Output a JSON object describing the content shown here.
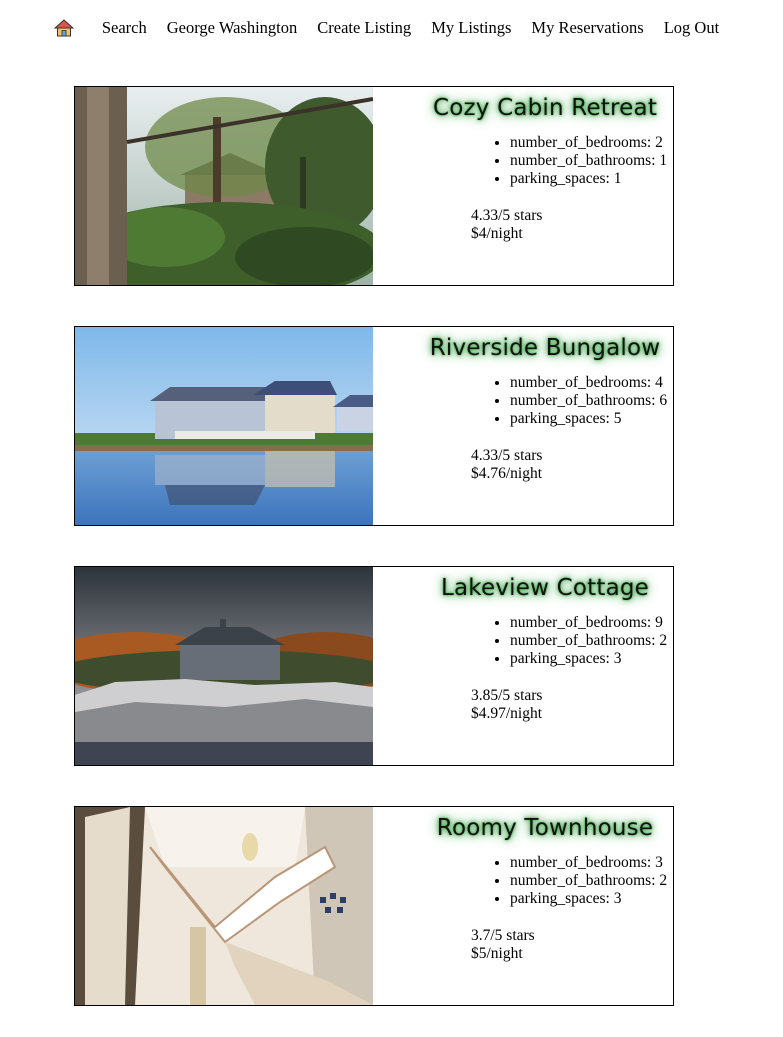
{
  "nav": {
    "home_icon": "home-icon",
    "links": [
      "Search",
      "George Washington",
      "Create Listing",
      "My Listings",
      "My Reservations",
      "Log Out"
    ]
  },
  "listings": [
    {
      "title": "Cozy Cabin Retreat",
      "features": [
        "number_of_bedrooms: 2",
        "number_of_bathrooms: 1",
        "parking_spaces: 1"
      ],
      "rating": "4.33/5 stars",
      "price": "$4/night"
    },
    {
      "title": "Riverside Bungalow",
      "features": [
        "number_of_bedrooms: 4",
        "number_of_bathrooms: 6",
        "parking_spaces: 5"
      ],
      "rating": "4.33/5 stars",
      "price": "$4.76/night"
    },
    {
      "title": "Lakeview Cottage",
      "features": [
        "number_of_bedrooms: 9",
        "number_of_bathrooms: 2",
        "parking_spaces: 3"
      ],
      "rating": "3.85/5 stars",
      "price": "$4.97/night"
    },
    {
      "title": "Roomy Townhouse",
      "features": [
        "number_of_bedrooms: 3",
        "number_of_bathrooms: 2",
        "parking_spaces: 3"
      ],
      "rating": "3.7/5 stars",
      "price": "$5/night"
    }
  ]
}
